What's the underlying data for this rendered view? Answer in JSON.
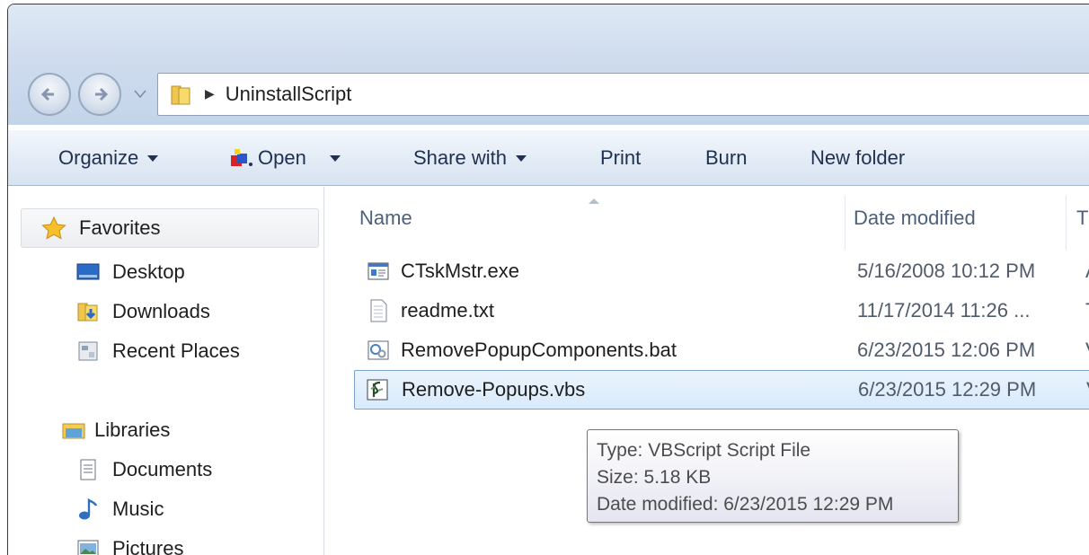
{
  "window": {
    "address": {
      "crumb": "UninstallScript"
    },
    "toolbar": {
      "organize": "Organize",
      "open": "Open",
      "share_with": "Share with",
      "print": "Print",
      "burn": "Burn",
      "new_folder": "New folder"
    },
    "nav": {
      "favorites": "Favorites",
      "favorites_items": [
        "Desktop",
        "Downloads",
        "Recent Places"
      ],
      "libraries": "Libraries",
      "libraries_items": [
        "Documents",
        "Music",
        "Pictures"
      ]
    },
    "columns": {
      "name": "Name",
      "date_modified": "Date modified",
      "type_partial": "T"
    },
    "files": [
      {
        "name": "CTskMstr.exe",
        "date": "5/16/2008 10:12 PM",
        "type": "A",
        "icon": "exe-icon"
      },
      {
        "name": "readme.txt",
        "date": "11/17/2014 11:26 ...",
        "type": "T",
        "icon": "text-file-icon"
      },
      {
        "name": "RemovePopupComponents.bat",
        "date": "6/23/2015 12:06 PM",
        "type": "V",
        "icon": "batch-file-icon"
      },
      {
        "name": "Remove-Popups.vbs",
        "date": "6/23/2015 12:29 PM",
        "type": "V",
        "icon": "vbscript-file-icon",
        "selected": true
      }
    ],
    "tooltip": {
      "type": "Type: VBScript Script File",
      "size": "Size: 5.18 KB",
      "date": "Date modified: 6/23/2015 12:29 PM"
    }
  }
}
